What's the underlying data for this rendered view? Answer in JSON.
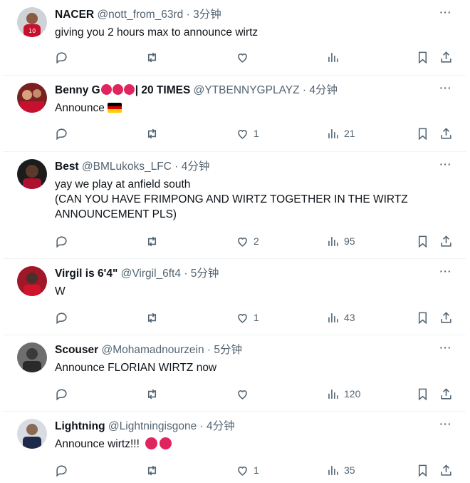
{
  "colors": {
    "accent_red": "#e0245e",
    "flag_black": "#000000",
    "flag_red": "#dd0000",
    "flag_gold": "#ffce00",
    "muted_text": "#536471"
  },
  "tweets": [
    {
      "name": "NACER",
      "handle": "@nott_from_63rd",
      "dot": "·",
      "time": "3分钟",
      "text": "giving you 2 hours max to announce wirtz",
      "likes": "",
      "views": ""
    },
    {
      "name_prefix": "Benny G",
      "name_suffix": "| 20 TIMES",
      "handle": "@YTBENNYGPLAYZ",
      "dot": "·",
      "time": "4分钟",
      "text": "Announce",
      "likes": "1",
      "views": "21"
    },
    {
      "name": "Best",
      "handle": "@BMLukoks_LFC",
      "dot": "·",
      "time": "4分钟",
      "text_lines": [
        "yay we play at anfield south",
        "(CAN YOU HAVE FRIMPONG AND WIRTZ TOGETHER IN THE WIRTZ",
        "ANNOUNCEMENT PLS)"
      ],
      "likes": "2",
      "views": "95"
    },
    {
      "name": "Virgil is 6'4\"",
      "handle": "@Virgil_6ft4",
      "dot": "·",
      "time": "5分钟",
      "text": "W",
      "likes": "1",
      "views": "43"
    },
    {
      "name": "Scouser",
      "handle": "@Mohamadnourzein",
      "dot": "·",
      "time": "5分钟",
      "text": "Announce FLORIAN WIRTZ now",
      "likes": "",
      "views": "120"
    },
    {
      "name": "Lightning",
      "handle": "@Lightningisgone",
      "dot": "·",
      "time": "4分钟",
      "text": "Announce wirtz!!!",
      "likes": "1",
      "views": "35"
    }
  ],
  "more_glyph": "···"
}
